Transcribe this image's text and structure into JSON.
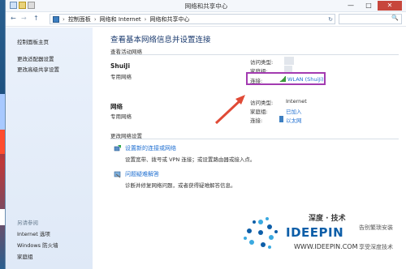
{
  "window": {
    "title": "网络和共享中心",
    "controls": {
      "minimize": "—",
      "maximize": "□",
      "close": "✕"
    }
  },
  "address": {
    "back": "←",
    "forward": "→",
    "up": "↑",
    "breadcrumb": [
      "控制面板",
      "网络和 Internet",
      "网络和共享中心"
    ],
    "separator": "›",
    "refresh": "↻",
    "search": "🔍"
  },
  "sidebar": {
    "links": [
      "控制面板主页",
      "更改适配器设置",
      "更改高级共享设置"
    ],
    "see_also_heading": "另请参阅",
    "see_also": [
      "Internet 选项",
      "Windows 防火墙",
      "家庭组"
    ]
  },
  "main": {
    "title": "查看基本网络信息并设置连接",
    "active_networks_label": "查看活动网络",
    "networks": [
      {
        "name": "ShuiJi",
        "type": "专用网络",
        "access_label": "访问类型:",
        "homegroup_label": "家庭组:",
        "connection_label": "连接:",
        "connection_value": "WLAN (ShuiJi)"
      },
      {
        "name": "网络",
        "type": "专用网络",
        "access_label": "访问类型:",
        "access_value": "Internet",
        "homegroup_label": "家庭组:",
        "homegroup_value": "已加入",
        "connection_label": "连接:",
        "connection_value": "以太网"
      }
    ],
    "change_settings_label": "更改网络设置",
    "tasks": [
      {
        "title": "设置新的连接或网络",
        "desc": "设置宽带、拨号或 VPN 连接；或设置路由器或接入点。"
      },
      {
        "title": "问题疑难解答",
        "desc": "诊断并修复网络问题，或者获得疑难解答信息。"
      }
    ]
  },
  "watermark": {
    "cn": "深度 · 技术",
    "en": "IDEEPIN",
    "url": "WWW.IDEEPIN.COM",
    "right1": "告别繁琐安装",
    "right2": "享受深度技术"
  },
  "colors": {
    "link": "#1f6fd1",
    "highlight": "#a33bb1",
    "arrow": "#e04a36",
    "sidebar": "#e4edf9"
  }
}
